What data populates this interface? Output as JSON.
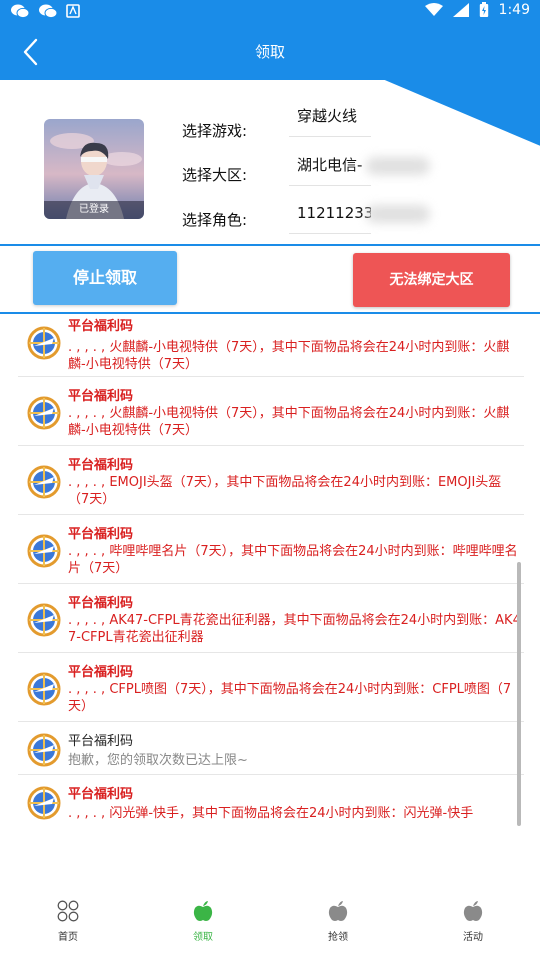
{
  "status_bar": {
    "time": "1:49"
  },
  "header": {
    "title": "领取"
  },
  "profile": {
    "avatar_label": "已登录",
    "game_label": "选择游戏:",
    "game_value": "穿越火线",
    "region_label": "选择大区:",
    "region_value": "湖北电信-",
    "role_label": "选择角色:",
    "role_value": "11211233"
  },
  "actions": {
    "stop_label": "停止领取",
    "bind_label": "无法绑定大区"
  },
  "messages": [
    {
      "title": "平台福利码",
      "body": ". , , . , 火麒麟-小电视特供（7天），其中下面物品将会在24小时内到账：火麒麟-小电视特供（7天）",
      "style": "red"
    },
    {
      "title": "平台福利码",
      "body": ". , , . , 火麒麟-小电视特供（7天），其中下面物品将会在24小时内到账：火麒麟-小电视特供（7天）",
      "style": "red"
    },
    {
      "title": "平台福利码",
      "body": ". , , . , EMOJI头盔（7天），其中下面物品将会在24小时内到账：EMOJI头盔（7天）",
      "style": "red"
    },
    {
      "title": "平台福利码",
      "body": ". , , . , 哔哩哔哩名片（7天），其中下面物品将会在24小时内到账：哔哩哔哩名片（7天）",
      "style": "red"
    },
    {
      "title": "平台福利码",
      "body": ". , , . , AK47-CFPL青花瓷出征利器，其中下面物品将会在24小时内到账：AK47-CFPL青花瓷出征利器",
      "style": "red"
    },
    {
      "title": "平台福利码",
      "body": ". , , . , CFPL喷图（7天），其中下面物品将会在24小时内到账：CFPL喷图（7天）",
      "style": "red"
    },
    {
      "title": "平台福利码",
      "body": "抱歉，您的领取次数已达上限~",
      "style": "gray"
    },
    {
      "title": "平台福利码",
      "body": ". , , . , 闪光弹-快手，其中下面物品将会在24小时内到账：闪光弹-快手",
      "style": "red"
    }
  ],
  "nav": [
    {
      "label": "首页",
      "icon": "grid-icon",
      "active": false
    },
    {
      "label": "领取",
      "icon": "apple-icon",
      "active": true
    },
    {
      "label": "抢领",
      "icon": "apple-icon",
      "active": false
    },
    {
      "label": "活动",
      "icon": "apple-icon",
      "active": false
    }
  ],
  "colors": {
    "primary": "#1a8ce8",
    "stop_button": "#55aef0",
    "bind_button": "#ee5555",
    "message_red": "#d92020",
    "nav_active": "#3bb546"
  }
}
